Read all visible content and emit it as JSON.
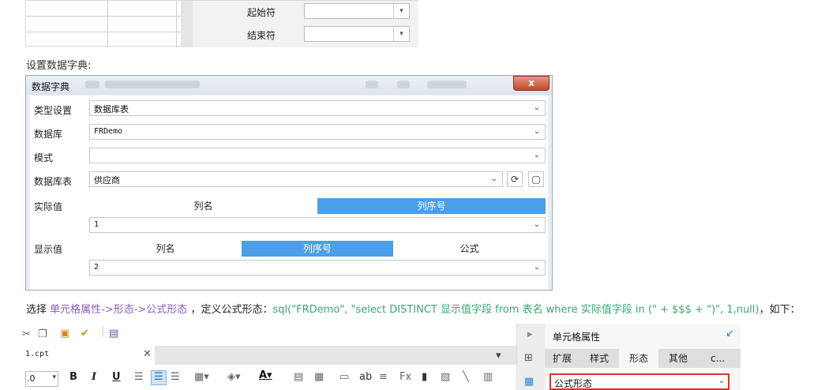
{
  "top_fragment": {
    "labels": [
      "起始符",
      "结束符"
    ],
    "dropdown_arrow": "▾"
  },
  "caption": "设置数据字典:",
  "dialog": {
    "title": "数据字典",
    "close": "x",
    "fields": {
      "type_label": "类型设置",
      "type_value": "数据库表",
      "db_label": "数据库",
      "db_value": "FRDemo",
      "schema_label": "模式",
      "schema_value": "",
      "table_label": "数据库表",
      "table_value": "供应商"
    },
    "actual": {
      "label": "实际值",
      "options": [
        "列名",
        "列序号"
      ],
      "selected": "列序号",
      "value": "1"
    },
    "display": {
      "label": "显示值",
      "options": [
        "列名",
        "列序号",
        "公式"
      ],
      "selected": "列序号",
      "value": "2"
    },
    "icons": [
      "refresh-icon",
      "preview-icon"
    ]
  },
  "instruction": {
    "prefix": "选择 ",
    "path": "单元格属性->形态->公式形态",
    "middle": " ，定义公式形态：",
    "formula": "sql(\"FRDemo\", \"select DISTINCT 显示值字段 from 表名 where 实际值字段 in (\" + $$$ + \")\", 1,null)",
    "suffix": "，如下："
  },
  "designer": {
    "file_tab": "1.cpt",
    "font_size": ".0",
    "format_buttons": [
      "B",
      "I",
      "U"
    ],
    "panel": {
      "title": "单元格属性",
      "tabs": [
        "扩展",
        "样式",
        "形态",
        "其他",
        "c..."
      ],
      "active_tab": "形态",
      "form_select": "公式形态"
    }
  },
  "colors": {
    "accent_blue": "#4a9fe8",
    "purple_link": "#8a5bbd",
    "green_formula": "#3aa870",
    "highlight_red": "#e0312a"
  }
}
